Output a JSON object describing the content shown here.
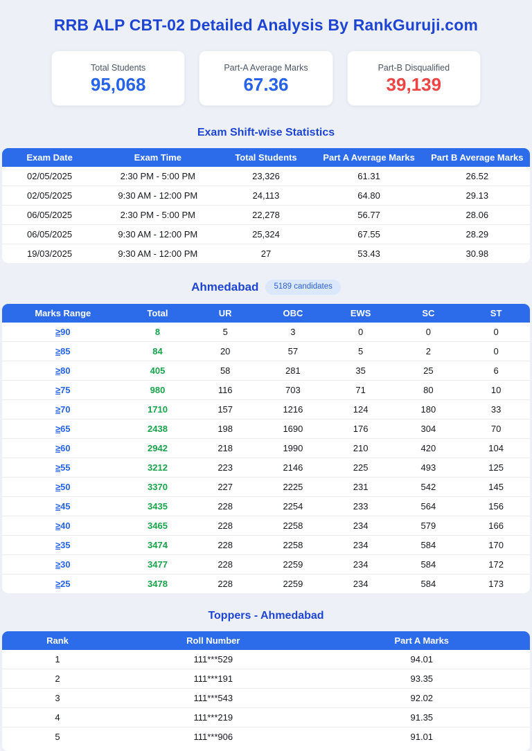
{
  "page": {
    "title": "RRB ALP CBT-02 Detailed Analysis By RankGuruji.com"
  },
  "summary_cards": [
    {
      "label": "Total Students",
      "value": "95,068"
    },
    {
      "label": "Part-A Average Marks",
      "value": "67.36"
    },
    {
      "label": "Part-B Disqualified",
      "value": "39,139"
    }
  ],
  "shift_table": {
    "heading": "Exam Shift-wise Statistics",
    "columns": [
      "Exam Date",
      "Exam Time",
      "Total Students",
      "Part A Average Marks",
      "Part B Average Marks"
    ],
    "rows": [
      [
        "02/05/2025",
        "2:30 PM - 5:00 PM",
        "23,326",
        "61.31",
        "26.52"
      ],
      [
        "02/05/2025",
        "9:30 AM - 12:00 PM",
        "24,113",
        "64.80",
        "29.13"
      ],
      [
        "06/05/2025",
        "2:30 PM - 5:00 PM",
        "22,278",
        "56.77",
        "28.06"
      ],
      [
        "06/05/2025",
        "9:30 AM - 12:00 PM",
        "25,324",
        "67.55",
        "28.29"
      ],
      [
        "19/03/2025",
        "9:30 AM - 12:00 PM",
        "27",
        "53.43",
        "30.98"
      ]
    ]
  },
  "city_table": {
    "heading": "Ahmedabad",
    "badge": "5189 candidates",
    "range_prefix": "≥",
    "columns": [
      "Marks Range",
      "Total",
      "UR",
      "OBC",
      "EWS",
      "SC",
      "ST"
    ],
    "rows": [
      [
        "90",
        "8",
        "5",
        "3",
        "0",
        "0",
        "0"
      ],
      [
        "85",
        "84",
        "20",
        "57",
        "5",
        "2",
        "0"
      ],
      [
        "80",
        "405",
        "58",
        "281",
        "35",
        "25",
        "6"
      ],
      [
        "75",
        "980",
        "116",
        "703",
        "71",
        "80",
        "10"
      ],
      [
        "70",
        "1710",
        "157",
        "1216",
        "124",
        "180",
        "33"
      ],
      [
        "65",
        "2438",
        "198",
        "1690",
        "176",
        "304",
        "70"
      ],
      [
        "60",
        "2942",
        "218",
        "1990",
        "210",
        "420",
        "104"
      ],
      [
        "55",
        "3212",
        "223",
        "2146",
        "225",
        "493",
        "125"
      ],
      [
        "50",
        "3370",
        "227",
        "2225",
        "231",
        "542",
        "145"
      ],
      [
        "45",
        "3435",
        "228",
        "2254",
        "233",
        "564",
        "156"
      ],
      [
        "40",
        "3465",
        "228",
        "2258",
        "234",
        "579",
        "166"
      ],
      [
        "35",
        "3474",
        "228",
        "2258",
        "234",
        "584",
        "170"
      ],
      [
        "30",
        "3477",
        "228",
        "2259",
        "234",
        "584",
        "172"
      ],
      [
        "25",
        "3478",
        "228",
        "2259",
        "234",
        "584",
        "173"
      ]
    ]
  },
  "toppers_table": {
    "heading": "Toppers - Ahmedabad",
    "columns": [
      "Rank",
      "Roll Number",
      "Part A Marks"
    ],
    "rows": [
      [
        "1",
        "111***529",
        "94.01"
      ],
      [
        "2",
        "111***191",
        "93.35"
      ],
      [
        "3",
        "111***543",
        "92.02"
      ],
      [
        "4",
        "111***219",
        "91.35"
      ],
      [
        "5",
        "111***906",
        "91.01"
      ]
    ]
  },
  "colors": {
    "page_bg": "#edf1f7",
    "heading_blue": "#1d44d2",
    "header_bar_blue": "#2c6bea",
    "link_blue": "#2563eb",
    "positive_green": "#17a34a",
    "alert_red": "#ef4444",
    "badge_bg": "#dbe8fc"
  }
}
